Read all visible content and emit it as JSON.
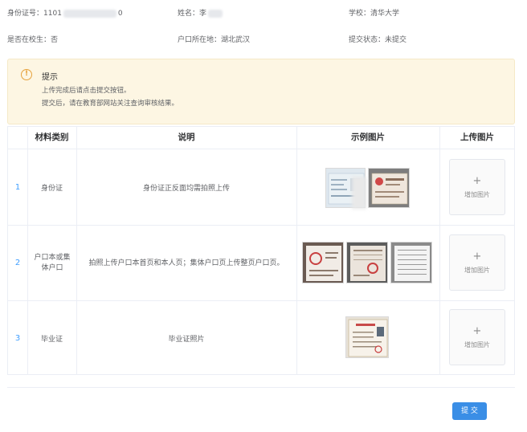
{
  "info": {
    "id_label": "身份证号：",
    "id_prefix": "1101",
    "id_suffix": "0",
    "name_label": "姓名：",
    "name_value": "李",
    "school_label": "学校：",
    "school_value": "清华大学",
    "in_school_label": "是否在校生：",
    "in_school_value": "否",
    "hukou_label": "户口所在地：",
    "hukou_value": "湖北武汉",
    "status_label": "提交状态：",
    "status_value": "未提交"
  },
  "tip": {
    "icon": "info-circle-icon",
    "icon_glyph": "!",
    "title": "提示",
    "line1": "上传完成后请点击提交按钮。",
    "line2": "提交后，请在教育部网站关注查询审核结果。"
  },
  "table": {
    "headers": [
      "材料类别",
      "说明",
      "示例图片",
      "上传图片"
    ],
    "rows": [
      {
        "index": "1",
        "category": "身份证",
        "description": "身份证正反面均需拍照上传"
      },
      {
        "index": "2",
        "category": "户口本或集体户口",
        "description": "拍照上传户口本首页和本人页；集体户口页上传整页户口页。"
      },
      {
        "index": "3",
        "category": "毕业证",
        "description": "毕业证照片"
      }
    ],
    "upload_label": "增加图片",
    "upload_plus": "+"
  },
  "footer": {
    "submit_label": "提 交"
  },
  "colors": {
    "accent": "#409eff",
    "button": "#3a8ee6",
    "warning": "#e6a23c",
    "tip_bg": "#fdf6e3"
  }
}
